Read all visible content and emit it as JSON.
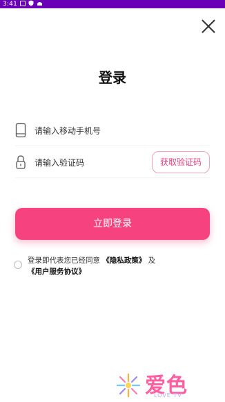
{
  "status_bar": {
    "time": "3:41"
  },
  "title": "登录",
  "phone_field": {
    "placeholder": "请输入移动手机号"
  },
  "code_field": {
    "placeholder": "请输入验证码"
  },
  "get_code_button": "获取验证码",
  "login_button": "立即登录",
  "agreement": {
    "prefix": "登录即代表您已经同意 ",
    "privacy_link": "《隐私政策》",
    "and": " 及 ",
    "terms_link": "《用户服务协议》"
  },
  "logo": {
    "text": "爱色",
    "subtext": "LOVE TV"
  },
  "colors": {
    "status_bar": "#6a00b8",
    "accent": "#f6437f",
    "code_button_border": "#f0a2be"
  }
}
